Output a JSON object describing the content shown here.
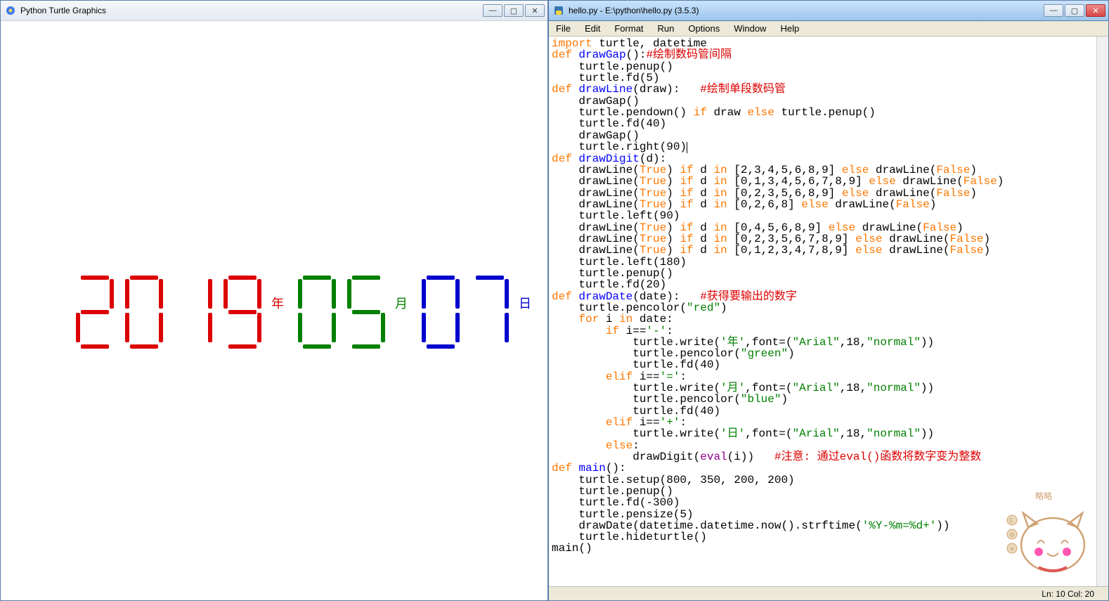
{
  "turtle": {
    "title": "Python Turtle Graphics",
    "date": {
      "year_digits": [
        2,
        0,
        1,
        9
      ],
      "month_digits": [
        0,
        5
      ],
      "day_digits": [
        0,
        7
      ],
      "year_label": "年",
      "month_label": "月",
      "day_label": "日",
      "year_color": "#dc0000",
      "month_color": "#008000",
      "day_color": "#0000cd"
    }
  },
  "idle": {
    "title": "hello.py - E:\\python\\hello.py (3.5.3)",
    "menu": [
      "File",
      "Edit",
      "Format",
      "Run",
      "Options",
      "Window",
      "Help"
    ],
    "status": "Ln: 10   Col: 20"
  },
  "code": [
    {
      "indent": 0,
      "tokens": [
        [
          "kw",
          "import"
        ],
        [
          "",
          " turtle, datetime"
        ]
      ]
    },
    {
      "indent": 0,
      "tokens": [
        [
          "kw",
          "def"
        ],
        [
          "",
          " "
        ],
        [
          "fn",
          "drawGap"
        ],
        [
          "",
          "():"
        ],
        [
          "com",
          "#绘制数码管间隔"
        ]
      ]
    },
    {
      "indent": 1,
      "tokens": [
        [
          "",
          "turtle.penup()"
        ]
      ]
    },
    {
      "indent": 1,
      "tokens": [
        [
          "",
          "turtle.fd(5)"
        ]
      ]
    },
    {
      "indent": 0,
      "tokens": [
        [
          "kw",
          "def"
        ],
        [
          "",
          " "
        ],
        [
          "fn",
          "drawLine"
        ],
        [
          "",
          "(draw):   "
        ],
        [
          "com",
          "#绘制单段数码管"
        ]
      ]
    },
    {
      "indent": 1,
      "tokens": [
        [
          "",
          "drawGap()"
        ]
      ]
    },
    {
      "indent": 1,
      "tokens": [
        [
          "",
          "turtle.pendown() "
        ],
        [
          "kw",
          "if"
        ],
        [
          "",
          " draw "
        ],
        [
          "kw",
          "else"
        ],
        [
          "",
          " turtle.penup()"
        ]
      ]
    },
    {
      "indent": 1,
      "tokens": [
        [
          "",
          "turtle.fd(40)"
        ]
      ]
    },
    {
      "indent": 1,
      "tokens": [
        [
          "",
          "drawGap()"
        ]
      ]
    },
    {
      "indent": 1,
      "tokens": [
        [
          "",
          "turtle.right(90)"
        ]
      ]
    },
    {
      "indent": 0,
      "tokens": [
        [
          "kw",
          "def"
        ],
        [
          "",
          " "
        ],
        [
          "fn",
          "drawDigit"
        ],
        [
          "",
          "(d):"
        ]
      ]
    },
    {
      "indent": 1,
      "tokens": [
        [
          "",
          "drawLine("
        ],
        [
          "kw",
          "True"
        ],
        [
          "",
          ") "
        ],
        [
          "kw",
          "if"
        ],
        [
          "",
          " d "
        ],
        [
          "kw",
          "in"
        ],
        [
          "",
          " [2,3,4,5,6,8,9] "
        ],
        [
          "kw",
          "else"
        ],
        [
          "",
          " drawLine("
        ],
        [
          "kw",
          "False"
        ],
        [
          "",
          ")"
        ]
      ]
    },
    {
      "indent": 1,
      "tokens": [
        [
          "",
          "drawLine("
        ],
        [
          "kw",
          "True"
        ],
        [
          "",
          ") "
        ],
        [
          "kw",
          "if"
        ],
        [
          "",
          " d "
        ],
        [
          "kw",
          "in"
        ],
        [
          "",
          " [0,1,3,4,5,6,7,8,9] "
        ],
        [
          "kw",
          "else"
        ],
        [
          "",
          " drawLine("
        ],
        [
          "kw",
          "False"
        ],
        [
          "",
          ")"
        ]
      ]
    },
    {
      "indent": 1,
      "tokens": [
        [
          "",
          "drawLine("
        ],
        [
          "kw",
          "True"
        ],
        [
          "",
          ") "
        ],
        [
          "kw",
          "if"
        ],
        [
          "",
          " d "
        ],
        [
          "kw",
          "in"
        ],
        [
          "",
          " [0,2,3,5,6,8,9] "
        ],
        [
          "kw",
          "else"
        ],
        [
          "",
          " drawLine("
        ],
        [
          "kw",
          "False"
        ],
        [
          "",
          ")"
        ]
      ]
    },
    {
      "indent": 1,
      "tokens": [
        [
          "",
          "drawLine("
        ],
        [
          "kw",
          "True"
        ],
        [
          "",
          ") "
        ],
        [
          "kw",
          "if"
        ],
        [
          "",
          " d "
        ],
        [
          "kw",
          "in"
        ],
        [
          "",
          " [0,2,6,8] "
        ],
        [
          "kw",
          "else"
        ],
        [
          "",
          " drawLine("
        ],
        [
          "kw",
          "False"
        ],
        [
          "",
          ")"
        ]
      ]
    },
    {
      "indent": 1,
      "tokens": [
        [
          "",
          "turtle.left(90)"
        ]
      ]
    },
    {
      "indent": 1,
      "tokens": [
        [
          "",
          "drawLine("
        ],
        [
          "kw",
          "True"
        ],
        [
          "",
          ") "
        ],
        [
          "kw",
          "if"
        ],
        [
          "",
          " d "
        ],
        [
          "kw",
          "in"
        ],
        [
          "",
          " [0,4,5,6,8,9] "
        ],
        [
          "kw",
          "else"
        ],
        [
          "",
          " drawLine("
        ],
        [
          "kw",
          "False"
        ],
        [
          "",
          ")"
        ]
      ]
    },
    {
      "indent": 1,
      "tokens": [
        [
          "",
          "drawLine("
        ],
        [
          "kw",
          "True"
        ],
        [
          "",
          ") "
        ],
        [
          "kw",
          "if"
        ],
        [
          "",
          " d "
        ],
        [
          "kw",
          "in"
        ],
        [
          "",
          " [0,2,3,5,6,7,8,9] "
        ],
        [
          "kw",
          "else"
        ],
        [
          "",
          " drawLine("
        ],
        [
          "kw",
          "False"
        ],
        [
          "",
          ")"
        ]
      ]
    },
    {
      "indent": 1,
      "tokens": [
        [
          "",
          "drawLine("
        ],
        [
          "kw",
          "True"
        ],
        [
          "",
          ") "
        ],
        [
          "kw",
          "if"
        ],
        [
          "",
          " d "
        ],
        [
          "kw",
          "in"
        ],
        [
          "",
          " [0,1,2,3,4,7,8,9] "
        ],
        [
          "kw",
          "else"
        ],
        [
          "",
          " drawLine("
        ],
        [
          "kw",
          "False"
        ],
        [
          "",
          ")"
        ]
      ]
    },
    {
      "indent": 1,
      "tokens": [
        [
          "",
          "turtle.left(180)"
        ]
      ]
    },
    {
      "indent": 1,
      "tokens": [
        [
          "",
          "turtle.penup()"
        ]
      ]
    },
    {
      "indent": 1,
      "tokens": [
        [
          "",
          "turtle.fd(20)"
        ]
      ]
    },
    {
      "indent": 0,
      "tokens": [
        [
          "kw",
          "def"
        ],
        [
          "",
          " "
        ],
        [
          "fn",
          "drawDate"
        ],
        [
          "",
          "(date):   "
        ],
        [
          "com",
          "#获得要输出的数字"
        ]
      ]
    },
    {
      "indent": 1,
      "tokens": [
        [
          "",
          "turtle.pencolor("
        ],
        [
          "str",
          "\"red\""
        ],
        [
          "",
          ")"
        ]
      ]
    },
    {
      "indent": 1,
      "tokens": [
        [
          "kw",
          "for"
        ],
        [
          "",
          " i "
        ],
        [
          "kw",
          "in"
        ],
        [
          "",
          " date:"
        ]
      ]
    },
    {
      "indent": 2,
      "tokens": [
        [
          "kw",
          "if"
        ],
        [
          "",
          " i=="
        ],
        [
          "str",
          "'-'"
        ],
        [
          "",
          ":"
        ]
      ]
    },
    {
      "indent": 3,
      "tokens": [
        [
          "",
          "turtle.write("
        ],
        [
          "str",
          "'年'"
        ],
        [
          "",
          ",font=("
        ],
        [
          "str",
          "\"Arial\""
        ],
        [
          "",
          ",18,"
        ],
        [
          "str",
          "\"normal\""
        ],
        [
          "",
          "))"
        ]
      ]
    },
    {
      "indent": 3,
      "tokens": [
        [
          "",
          "turtle.pencolor("
        ],
        [
          "str",
          "\"green\""
        ],
        [
          "",
          ")"
        ]
      ]
    },
    {
      "indent": 3,
      "tokens": [
        [
          "",
          "turtle.fd(40)"
        ]
      ]
    },
    {
      "indent": 2,
      "tokens": [
        [
          "kw",
          "elif"
        ],
        [
          "",
          " i=="
        ],
        [
          "str",
          "'='"
        ],
        [
          "",
          ":"
        ]
      ]
    },
    {
      "indent": 3,
      "tokens": [
        [
          "",
          "turtle.write("
        ],
        [
          "str",
          "'月'"
        ],
        [
          "",
          ",font=("
        ],
        [
          "str",
          "\"Arial\""
        ],
        [
          "",
          ",18,"
        ],
        [
          "str",
          "\"normal\""
        ],
        [
          "",
          "))"
        ]
      ]
    },
    {
      "indent": 3,
      "tokens": [
        [
          "",
          "turtle.pencolor("
        ],
        [
          "str",
          "\"blue\""
        ],
        [
          "",
          ")"
        ]
      ]
    },
    {
      "indent": 3,
      "tokens": [
        [
          "",
          "turtle.fd(40)"
        ]
      ]
    },
    {
      "indent": 2,
      "tokens": [
        [
          "kw",
          "elif"
        ],
        [
          "",
          " i=="
        ],
        [
          "str",
          "'+'"
        ],
        [
          "",
          ":"
        ]
      ]
    },
    {
      "indent": 3,
      "tokens": [
        [
          "",
          "turtle.write("
        ],
        [
          "str",
          "'日'"
        ],
        [
          "",
          ",font=("
        ],
        [
          "str",
          "\"Arial\""
        ],
        [
          "",
          ",18,"
        ],
        [
          "str",
          "\"normal\""
        ],
        [
          "",
          "))"
        ]
      ]
    },
    {
      "indent": 2,
      "tokens": [
        [
          "kw",
          "else"
        ],
        [
          "",
          ":"
        ]
      ]
    },
    {
      "indent": 3,
      "tokens": [
        [
          "",
          "drawDigit("
        ],
        [
          "bi",
          "eval"
        ],
        [
          "",
          "(i))   "
        ],
        [
          "com",
          "#注意: 通过eval()函数将数字变为整数"
        ]
      ]
    },
    {
      "indent": 0,
      "tokens": [
        [
          "kw",
          "def"
        ],
        [
          "",
          " "
        ],
        [
          "fn",
          "main"
        ],
        [
          "",
          "():"
        ]
      ]
    },
    {
      "indent": 1,
      "tokens": [
        [
          "",
          "turtle.setup(800, 350, 200, 200)"
        ]
      ]
    },
    {
      "indent": 1,
      "tokens": [
        [
          "",
          "turtle.penup()"
        ]
      ]
    },
    {
      "indent": 1,
      "tokens": [
        [
          "",
          "turtle.fd(-300)"
        ]
      ]
    },
    {
      "indent": 1,
      "tokens": [
        [
          "",
          "turtle.pensize(5)"
        ]
      ]
    },
    {
      "indent": 1,
      "tokens": [
        [
          "",
          "drawDate(datetime.datetime.now().strftime("
        ],
        [
          "str",
          "'%Y-%m=%d+'"
        ],
        [
          "",
          "))"
        ]
      ]
    },
    {
      "indent": 1,
      "tokens": [
        [
          "",
          "turtle.hideturtle()"
        ]
      ]
    },
    {
      "indent": 0,
      "tokens": [
        [
          "",
          "main()"
        ]
      ]
    }
  ],
  "seg_map": {
    "0": [
      "a",
      "b",
      "c",
      "d",
      "e",
      "f"
    ],
    "1": [
      "b",
      "c"
    ],
    "2": [
      "a",
      "b",
      "g",
      "e",
      "d"
    ],
    "3": [
      "a",
      "b",
      "g",
      "c",
      "d"
    ],
    "4": [
      "f",
      "g",
      "b",
      "c"
    ],
    "5": [
      "a",
      "f",
      "g",
      "c",
      "d"
    ],
    "6": [
      "a",
      "f",
      "g",
      "e",
      "c",
      "d"
    ],
    "7": [
      "a",
      "b",
      "c"
    ],
    "8": [
      "a",
      "b",
      "c",
      "d",
      "e",
      "f",
      "g"
    ],
    "9": [
      "a",
      "b",
      "c",
      "d",
      "f",
      "g"
    ]
  },
  "sticker": {
    "text": "略略"
  }
}
